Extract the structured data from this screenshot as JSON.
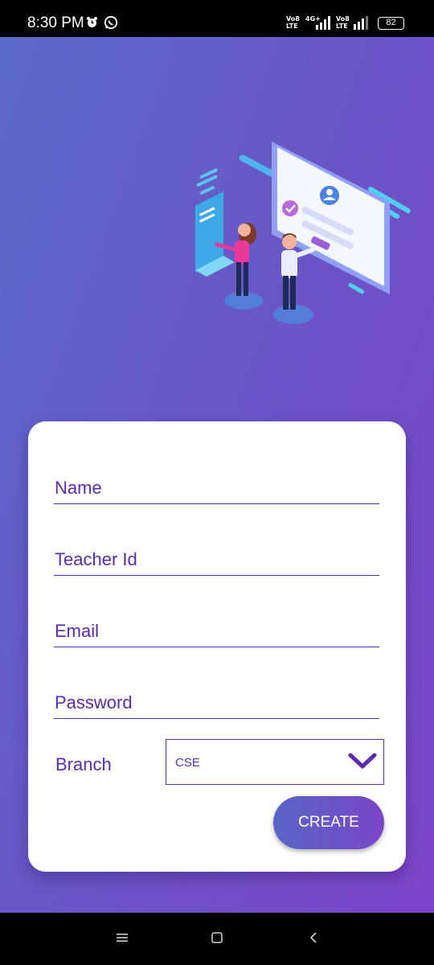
{
  "status_bar": {
    "time": "8:30 PM",
    "net1_top": "Vo8",
    "net1_bottom": "LTE",
    "net2_top": "4G+",
    "net3_top": "Vo8",
    "net3_bottom": "LTE",
    "battery": "82"
  },
  "form": {
    "name_label": "Name",
    "teacher_id_label": "Teacher Id",
    "email_label": "Email",
    "password_label": "Password",
    "branch_label": "Branch",
    "branch_selected": "CSE",
    "create_label": "CREATE"
  },
  "colors": {
    "accent": "#5a2bb0",
    "gradient_start": "#5a6bc8",
    "gradient_end": "#7c45c8"
  }
}
